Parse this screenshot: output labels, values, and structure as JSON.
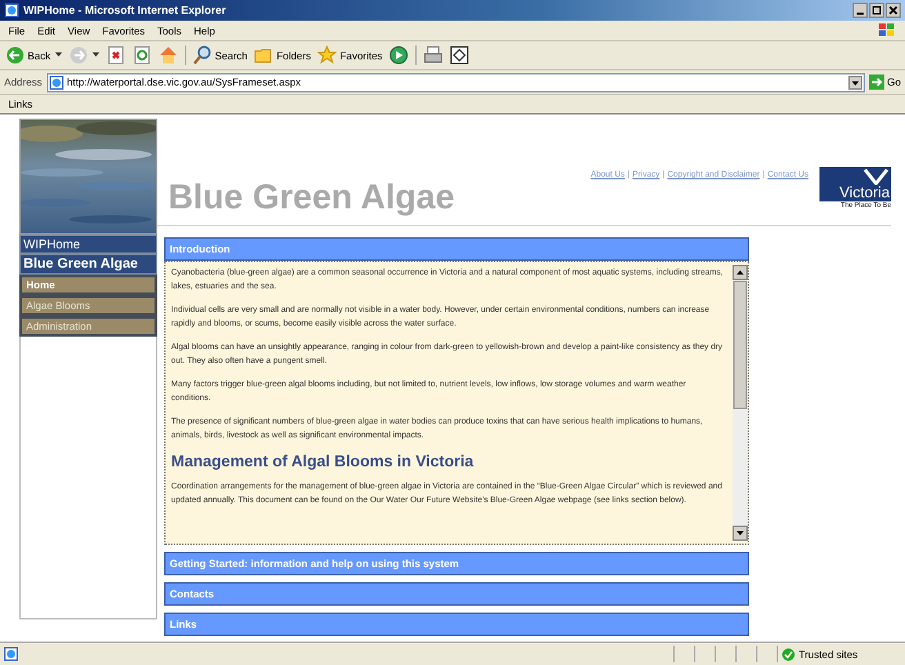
{
  "window": {
    "title": "WIPHome - Microsoft Internet Explorer"
  },
  "menu": [
    "File",
    "Edit",
    "View",
    "Favorites",
    "Tools",
    "Help"
  ],
  "toolbar": [
    {
      "kind": "back",
      "label": "Back"
    },
    {
      "kind": "forward"
    },
    {
      "kind": "stop"
    },
    {
      "kind": "refresh"
    },
    {
      "kind": "home"
    },
    {
      "kind": "search",
      "label": "Search"
    },
    {
      "kind": "folders",
      "label": "Folders"
    },
    {
      "kind": "favorites",
      "label": "Favorites"
    },
    {
      "kind": "media"
    },
    {
      "kind": "print"
    },
    {
      "kind": "edit"
    }
  ],
  "address": {
    "label": "Address",
    "value": "http://waterportal.dse.vic.gov.au/SysFrameset.aspx",
    "go": "Go"
  },
  "links_bar": {
    "label": "Links"
  },
  "page": {
    "title": "Blue Green Algae",
    "header_links": [
      "About Us",
      "Privacy",
      "Copyright and Disclaimer",
      "Contact Us"
    ],
    "separator": "|",
    "logo": {
      "name": "Victoria",
      "tagline": "The Place To Be"
    },
    "sidebar": {
      "site": "WIPHome",
      "section": "Blue Green Algae",
      "items": [
        {
          "label": "Home",
          "selected": true
        },
        {
          "label": "Algae Blooms",
          "selected": false
        },
        {
          "label": "Administration",
          "selected": false
        }
      ]
    },
    "panels": [
      {
        "title": "Introduction",
        "expanded": true,
        "content": [
          {
            "kind": "p",
            "text": "Cyanobacteria (blue-green algae) are a common seasonal occurrence in Victoria and a natural component of most aquatic systems, including streams, lakes, estuaries and the sea."
          },
          {
            "kind": "p",
            "text": "Individual cells are very small and are normally not visible in a water body. However, under certain environmental conditions, numbers can increase rapidly and blooms, or scums, become easily visible across the water surface."
          },
          {
            "kind": "p",
            "text": "Algal blooms can have an unsightly appearance, ranging in colour from dark-green to yellowish-brown and develop a paint-like consistency as they dry out. They also often have a pungent smell."
          },
          {
            "kind": "p",
            "text": "Many factors trigger blue-green algal blooms including, but not limited to, nutrient levels, low inflows, low storage volumes and warm weather conditions."
          },
          {
            "kind": "p",
            "text": "The presence of significant numbers of blue-green algae in water bodies can produce toxins that can have serious health implications to humans, animals, birds, livestock as well as significant environmental impacts."
          },
          {
            "kind": "h",
            "text": "Management of Algal Blooms in Victoria"
          },
          {
            "kind": "p",
            "text": "Coordination arrangements for the management of blue-green algae in Victoria are contained in the “Blue-Green Algae Circular” which is reviewed and updated annually. This document can be found on the Our Water Our Future Website's Blue-Green Algae webpage (see links section below)."
          }
        ]
      },
      {
        "title": "Getting Started: information and help on using this system",
        "expanded": false
      },
      {
        "title": "Contacts",
        "expanded": false
      },
      {
        "title": "Links",
        "expanded": false
      }
    ]
  },
  "status_bar": {
    "zone": "Trusted sites"
  }
}
